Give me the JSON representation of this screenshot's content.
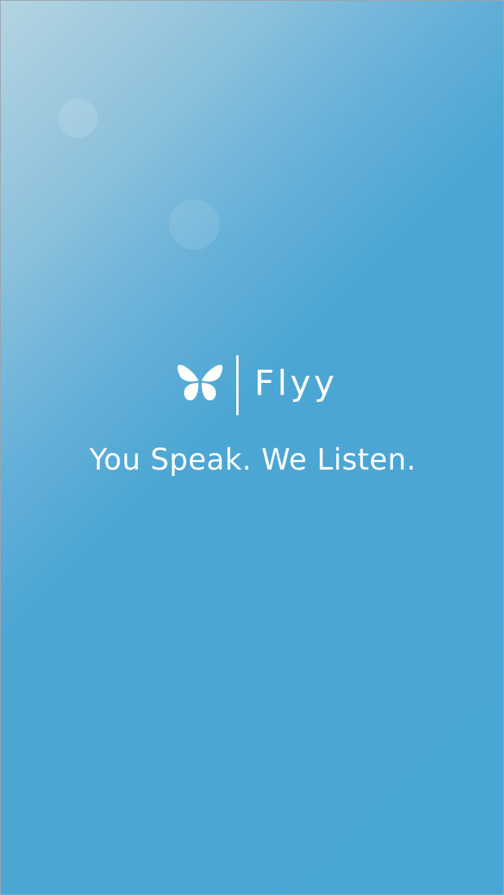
{
  "app": {
    "brand_name": "Flyy",
    "tagline": "You Speak. We Listen.",
    "logo_icon": "butterfly-icon"
  },
  "colors": {
    "background": "#4aa6d4",
    "background_highlight": "#b4d4e1",
    "text": "#ffffff"
  }
}
